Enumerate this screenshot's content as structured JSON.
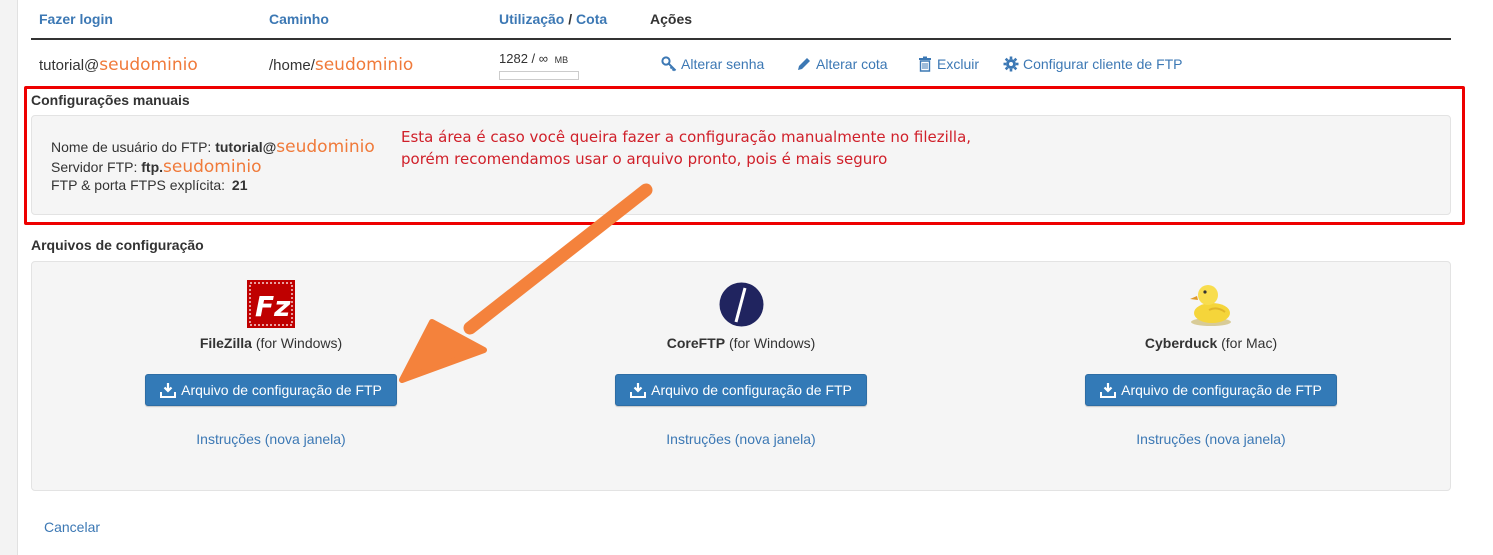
{
  "table": {
    "headers": {
      "login": "Fazer login",
      "path": "Caminho",
      "usage": "Utilização",
      "slash": "/",
      "quota": "Cota",
      "actions": "Ações"
    },
    "row": {
      "login_prefix": "tutorial@",
      "login_domain": "seudominio",
      "path_prefix": "/home/",
      "path_domain": "seudominio",
      "usage_text": "1282 / ∞",
      "usage_unit": "MB",
      "usage_fraction": 0
    },
    "actions": [
      {
        "label": "Alterar senha",
        "icon": "key-icon"
      },
      {
        "label": "Alterar cota",
        "icon": "pencil-icon"
      },
      {
        "label": "Excluir",
        "icon": "trash-icon"
      },
      {
        "label": "Configurar cliente de FTP",
        "icon": "gear-icon"
      }
    ]
  },
  "manual": {
    "title": "Configurações manuais",
    "username_label": "Nome de usuário do FTP:",
    "username_value": "tutorial@",
    "username_domain": "seudominio",
    "server_label": "Servidor FTP:",
    "server_value": "ftp.",
    "server_domain": "seudominio",
    "port_label": "FTP & porta FTPS explícita:",
    "port_value": "21",
    "note_line1": "Esta área é caso você queira fazer a configuração manualmente no filezilla,",
    "note_line2": "porém recomendamos usar o arquivo pronto, pois é mais seguro"
  },
  "config": {
    "title": "Arquivos de configuração",
    "clients": [
      {
        "name": "FileZilla",
        "platform": "(for Windows)",
        "button": "Arquivo de configuração de FTP",
        "instructions": "Instruções (nova janela)",
        "icon": "filezilla-logo"
      },
      {
        "name": "CoreFTP",
        "platform": "(for Windows)",
        "button": "Arquivo de configuração de FTP",
        "instructions": "Instruções (nova janela)",
        "icon": "coreftp-logo"
      },
      {
        "name": "Cyberduck",
        "platform": "(for Mac)",
        "button": "Arquivo de configuração de FTP",
        "instructions": "Instruções (nova janela)",
        "icon": "cyberduck-logo"
      }
    ]
  },
  "cancel": "Cancelar",
  "colors": {
    "link": "#3c78b4",
    "button": "#337ab7",
    "annotation_red": "#e00000",
    "arrow": "#f4823c",
    "domain_orange": "#f07a3a"
  }
}
